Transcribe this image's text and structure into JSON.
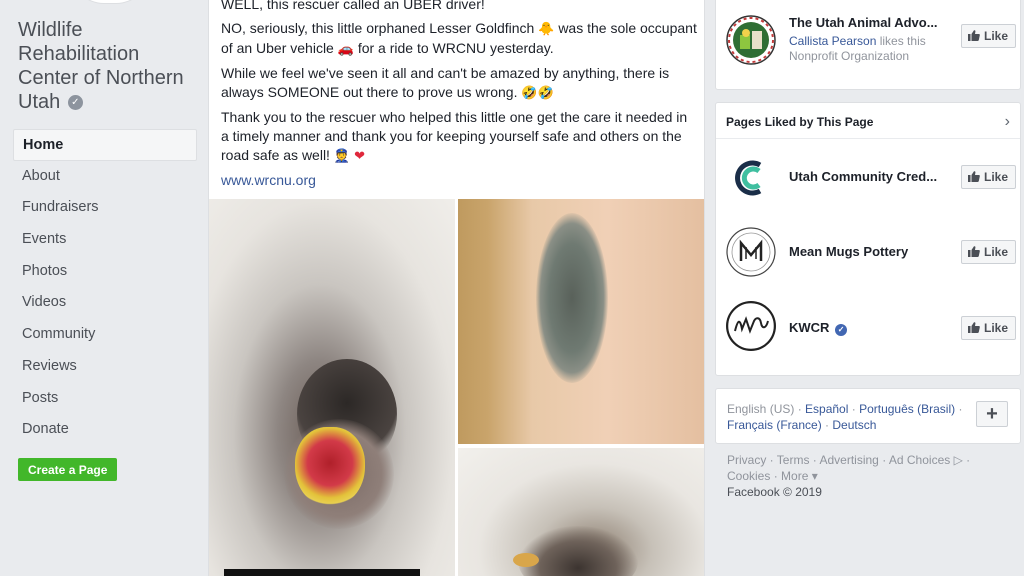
{
  "sidebar": {
    "page_name": "Wildlife Rehabilitation Center of Northern Utah",
    "verified_icon": "check",
    "nav": [
      "Home",
      "About",
      "Fundraisers",
      "Events",
      "Photos",
      "Videos",
      "Community",
      "Reviews",
      "Posts",
      "Donate"
    ],
    "active_nav": "Home",
    "create_page": "Create a Page"
  },
  "post": {
    "line1": "WELL, this rescuer called an UBER driver!",
    "p2_a": "NO, seriously, this little orphaned Lesser Goldfinch",
    "p2_emoji": "🐥",
    "p2_b": "was the sole occupant of an Uber vehicle",
    "p2_emoji2": "🚗",
    "p2_c": "for a ride to WRCNU yesterday.",
    "p3": "While we feel we've seen it all and can't be amazed by anything, there is always SOMEONE out there to prove us wrong.",
    "p3_emoji": "🤣🤣",
    "p4": "Thank you to the rescuer who helped this little one get the care it needed in a timely manner and thank you for keeping yourself safe and others on the road safe as well!",
    "p4_emoji": "👮 ❤",
    "link": "www.wrcnu.org"
  },
  "right": {
    "top_page": {
      "title": "The Utah Animal Advo...",
      "liker": "Callista Pearson",
      "likes_text": "likes this",
      "category": "Nonprofit Organization",
      "like_label": "Like"
    },
    "liked_header": "Pages Liked by This Page",
    "liked_pages": [
      {
        "name": "Utah Community Cred...",
        "like_label": "Like"
      },
      {
        "name": "Mean Mugs Pottery",
        "like_label": "Like"
      },
      {
        "name": "KWCR",
        "like_label": "Like"
      }
    ],
    "languages": {
      "current": "English (US)",
      "list": [
        "Español",
        "Português (Brasil)",
        "Français (France)",
        "Deutsch"
      ],
      "plus": "+"
    },
    "footer": {
      "links": [
        "Privacy",
        "Terms",
        "Advertising",
        "Ad Choices",
        "Cookies",
        "More"
      ],
      "copyright": "Facebook © 2019"
    }
  },
  "colors": {
    "fb_blue": "#4267b2",
    "link": "#385898",
    "green": "#42b72a",
    "bg": "#e9ebee"
  }
}
